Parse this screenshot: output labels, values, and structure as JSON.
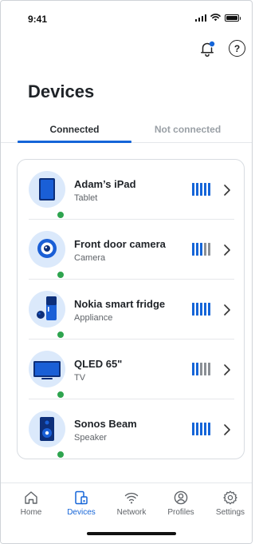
{
  "status_bar": {
    "time": "9:41"
  },
  "header": {
    "title": "Devices",
    "notification_icon": "bell-with-dot-icon",
    "help_icon": "help-circle-icon",
    "help_glyph": "?"
  },
  "tabs": [
    {
      "label": "Connected",
      "active": true
    },
    {
      "label": "Not connected",
      "active": false
    }
  ],
  "colors": {
    "accent": "#1565d8",
    "online": "#2ea44f",
    "signal_active": "#1565d8",
    "signal_inactive": "#8a8f95",
    "avatar_bg": "#dbe9fb"
  },
  "devices": [
    {
      "name": "Adam’s iPad",
      "type": "Tablet",
      "icon": "tablet-icon",
      "status": "online",
      "signal_level": 5,
      "signal_max": 5
    },
    {
      "name": "Front door camera",
      "type": "Camera",
      "icon": "camera-icon",
      "status": "online",
      "signal_level": 3,
      "signal_max": 5
    },
    {
      "name": "Nokia smart fridge",
      "type": "Appliance",
      "icon": "fridge-icon",
      "status": "online",
      "signal_level": 5,
      "signal_max": 5
    },
    {
      "name": "QLED 65\"",
      "type": "TV",
      "icon": "tv-icon",
      "status": "online",
      "signal_level": 2,
      "signal_max": 5
    },
    {
      "name": "Sonos Beam",
      "type": "Speaker",
      "icon": "speaker-icon",
      "status": "online",
      "signal_level": 5,
      "signal_max": 5
    }
  ],
  "bottom_nav": [
    {
      "label": "Home",
      "icon": "home-icon",
      "active": false
    },
    {
      "label": "Devices",
      "icon": "devices-icon",
      "active": true
    },
    {
      "label": "Network",
      "icon": "wifi-icon",
      "active": false
    },
    {
      "label": "Profiles",
      "icon": "profile-icon",
      "active": false
    },
    {
      "label": "Settings",
      "icon": "gear-icon",
      "active": false
    }
  ]
}
